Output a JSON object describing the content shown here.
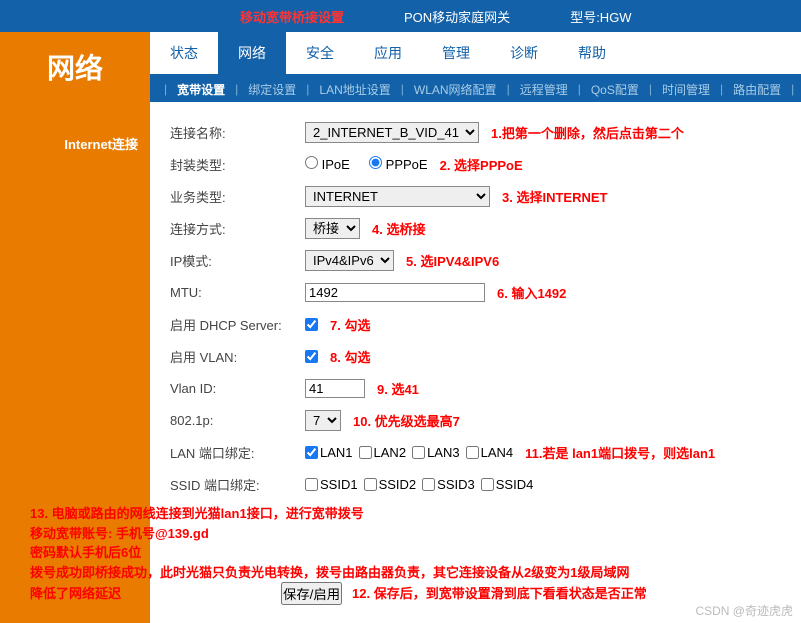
{
  "topbar": {
    "title": "移动宽带桥接设置",
    "pon": "PON移动家庭网关",
    "model": "型号:HGW"
  },
  "logo": "网络",
  "nav1": [
    "状态",
    "网络",
    "安全",
    "应用",
    "管理",
    "诊断",
    "帮助"
  ],
  "nav2": [
    "宽带设置",
    "绑定设置",
    "LAN地址设置",
    "WLAN网络配置",
    "远程管理",
    "QoS配置",
    "时间管理",
    "路由配置"
  ],
  "sidebar": {
    "label": "Internet连接"
  },
  "form": {
    "conn_name_label": "连接名称:",
    "conn_name_value": "2_INTERNET_B_VID_41",
    "encap_label": "封装类型:",
    "encap_ipoe": "IPoE",
    "encap_pppoe": "PPPoE",
    "biz_label": "业务类型:",
    "biz_value": "INTERNET",
    "mode_label": "连接方式:",
    "mode_value": "桥接",
    "ip_label": "IP模式:",
    "ip_value": "IPv4&IPv6",
    "mtu_label": "MTU:",
    "mtu_value": "1492",
    "dhcp_label": "启用 DHCP Server:",
    "vlan_label": "启用 VLAN:",
    "vlanid_label": "Vlan ID:",
    "vlanid_value": "41",
    "p8021_label": "802.1p:",
    "p8021_value": "7",
    "lan_label": "LAN 端口绑定:",
    "lan_opts": [
      "LAN1",
      "LAN2",
      "LAN3",
      "LAN4"
    ],
    "ssid_label": "SSID 端口绑定:",
    "ssid_opts": [
      "SSID1",
      "SSID2",
      "SSID3",
      "SSID4"
    ]
  },
  "notes": {
    "n1": "1.把第一个删除，然后点击第二个",
    "n2": "2. 选择PPPoE",
    "n3": "3. 选择INTERNET",
    "n4": "4. 选桥接",
    "n5": "5. 选IPV4&IPV6",
    "n6": "6. 输入1492",
    "n7": "7. 勾选",
    "n8": "8. 勾选",
    "n9": "9. 选41",
    "n10": "10. 优先级选最高7",
    "n11": "11.若是 lan1端口拨号，则选lan1",
    "n12": "12. 保存后，到宽带设置滑到底下看看状态是否正常",
    "f1": "13. 电脑或路由的网线连接到光猫lan1接口，进行宽带拨号",
    "f2": "移动宽带账号: 手机号@139.gd",
    "f3": "密码默认手机后6位",
    "f4": "拨号成功即桥接成功，此时光猫只负责光电转换，拨号由路由器负责，其它连接设备从2级变为1级局域网",
    "f5": "降低了网络延迟"
  },
  "save_btn": "保存/启用",
  "watermark": "CSDN @奇迹虎虎"
}
